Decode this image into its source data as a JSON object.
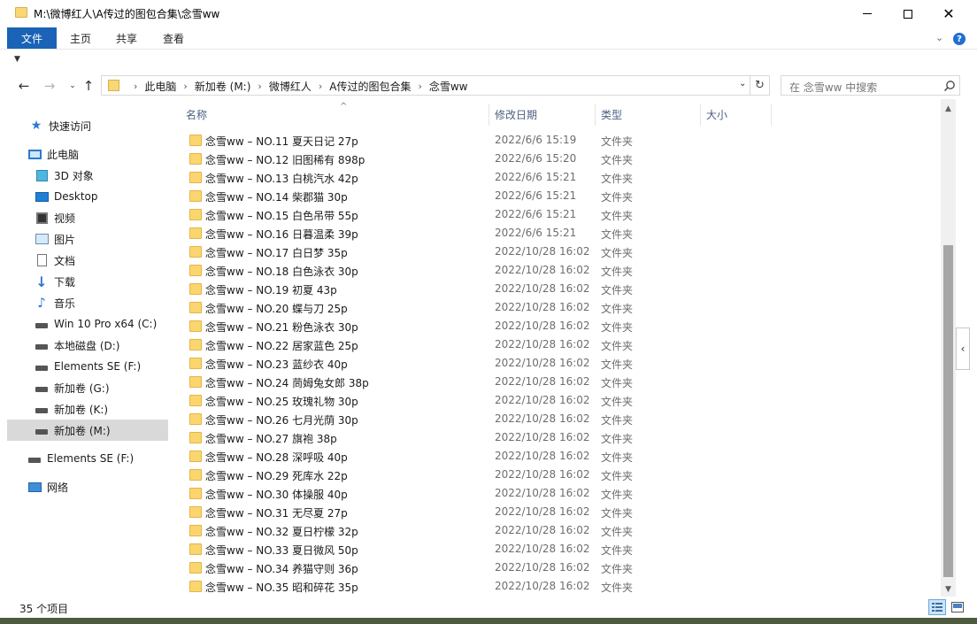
{
  "window": {
    "title": "M:\\微博红人\\A传过的图包合集\\念雪ww"
  },
  "ribbon": {
    "tabs": [
      "文件",
      "主页",
      "共享",
      "查看"
    ]
  },
  "address": {
    "crumbs": [
      "此电脑",
      "新加卷 (M:)",
      "微博红人",
      "A传过的图包合集",
      "念雪ww"
    ]
  },
  "search": {
    "placeholder": "在 念雪ww 中搜索"
  },
  "navpane": {
    "items": [
      {
        "label": "快速访问",
        "icon": "star-icon"
      },
      {
        "label": "此电脑",
        "icon": "computer-icon"
      },
      {
        "label": "3D 对象",
        "icon": "cube-icon"
      },
      {
        "label": "Desktop",
        "icon": "desktop-icon"
      },
      {
        "label": "视频",
        "icon": "video-icon"
      },
      {
        "label": "图片",
        "icon": "picture-icon"
      },
      {
        "label": "文档",
        "icon": "document-icon"
      },
      {
        "label": "下载",
        "icon": "download-icon"
      },
      {
        "label": "音乐",
        "icon": "music-icon"
      },
      {
        "label": "Win 10 Pro x64 (C:)",
        "icon": "drive-icon"
      },
      {
        "label": "本地磁盘 (D:)",
        "icon": "drive-icon"
      },
      {
        "label": "Elements SE (F:)",
        "icon": "drive-icon"
      },
      {
        "label": "新加卷 (G:)",
        "icon": "drive-icon"
      },
      {
        "label": "新加卷 (K:)",
        "icon": "drive-icon"
      },
      {
        "label": "新加卷 (M:)",
        "icon": "drive-icon"
      },
      {
        "label": "Elements SE (F:)",
        "icon": "drive-icon"
      },
      {
        "label": "网络",
        "icon": "network-icon"
      }
    ]
  },
  "columns": {
    "name": "名称",
    "date": "修改日期",
    "type": "类型",
    "size": "大小"
  },
  "files": [
    {
      "name": "念雪ww – NO.11 夏天日记 27p",
      "date": "2022/6/6 15:19",
      "type": "文件夹"
    },
    {
      "name": "念雪ww – NO.12 旧图稀有 898p",
      "date": "2022/6/6 15:20",
      "type": "文件夹"
    },
    {
      "name": "念雪ww – NO.13 白桃汽水 42p",
      "date": "2022/6/6 15:21",
      "type": "文件夹"
    },
    {
      "name": "念雪ww – NO.14 柴郡猫 30p",
      "date": "2022/6/6 15:21",
      "type": "文件夹"
    },
    {
      "name": "念雪ww – NO.15 白色吊带 55p",
      "date": "2022/6/6 15:21",
      "type": "文件夹"
    },
    {
      "name": "念雪ww – NO.16 日暮温柔 39p",
      "date": "2022/6/6 15:21",
      "type": "文件夹"
    },
    {
      "name": "念雪ww – NO.17 白日梦 35p",
      "date": "2022/10/28 16:02",
      "type": "文件夹"
    },
    {
      "name": "念雪ww – NO.18 白色泳衣 30p",
      "date": "2022/10/28 16:02",
      "type": "文件夹"
    },
    {
      "name": "念雪ww – NO.19 初夏 43p",
      "date": "2022/10/28 16:02",
      "type": "文件夹"
    },
    {
      "name": "念雪ww – NO.20 蝶与刀 25p",
      "date": "2022/10/28 16:02",
      "type": "文件夹"
    },
    {
      "name": "念雪ww – NO.21 粉色泳衣 30p",
      "date": "2022/10/28 16:02",
      "type": "文件夹"
    },
    {
      "name": "念雪ww – NO.22 居家蓝色 25p",
      "date": "2022/10/28 16:02",
      "type": "文件夹"
    },
    {
      "name": "念雪ww – NO.23 蓝纱衣 40p",
      "date": "2022/10/28 16:02",
      "type": "文件夹"
    },
    {
      "name": "念雪ww – NO.24 茼姆兔女郎 38p",
      "date": "2022/10/28 16:02",
      "type": "文件夹"
    },
    {
      "name": "念雪ww – NO.25 玫瑰礼物 30p",
      "date": "2022/10/28 16:02",
      "type": "文件夹"
    },
    {
      "name": "念雪ww – NO.26 七月光荫 30p",
      "date": "2022/10/28 16:02",
      "type": "文件夹"
    },
    {
      "name": "念雪ww – NO.27 旗袍 38p",
      "date": "2022/10/28 16:02",
      "type": "文件夹"
    },
    {
      "name": "念雪ww – NO.28 深呼吸 40p",
      "date": "2022/10/28 16:02",
      "type": "文件夹"
    },
    {
      "name": "念雪ww – NO.29 死库水 22p",
      "date": "2022/10/28 16:02",
      "type": "文件夹"
    },
    {
      "name": "念雪ww – NO.30 体操服 40p",
      "date": "2022/10/28 16:02",
      "type": "文件夹"
    },
    {
      "name": "念雪ww – NO.31 无尽夏 27p",
      "date": "2022/10/28 16:02",
      "type": "文件夹"
    },
    {
      "name": "念雪ww – NO.32 夏日柠檬 32p",
      "date": "2022/10/28 16:02",
      "type": "文件夹"
    },
    {
      "name": "念雪ww – NO.33 夏日微风 50p",
      "date": "2022/10/28 16:02",
      "type": "文件夹"
    },
    {
      "name": "念雪ww – NO.34 养猫守则 36p",
      "date": "2022/10/28 16:02",
      "type": "文件夹"
    },
    {
      "name": "念雪ww – NO.35 昭和碎花 35p",
      "date": "2022/10/28 16:02",
      "type": "文件夹"
    }
  ],
  "status": {
    "count": "35 个项目"
  }
}
